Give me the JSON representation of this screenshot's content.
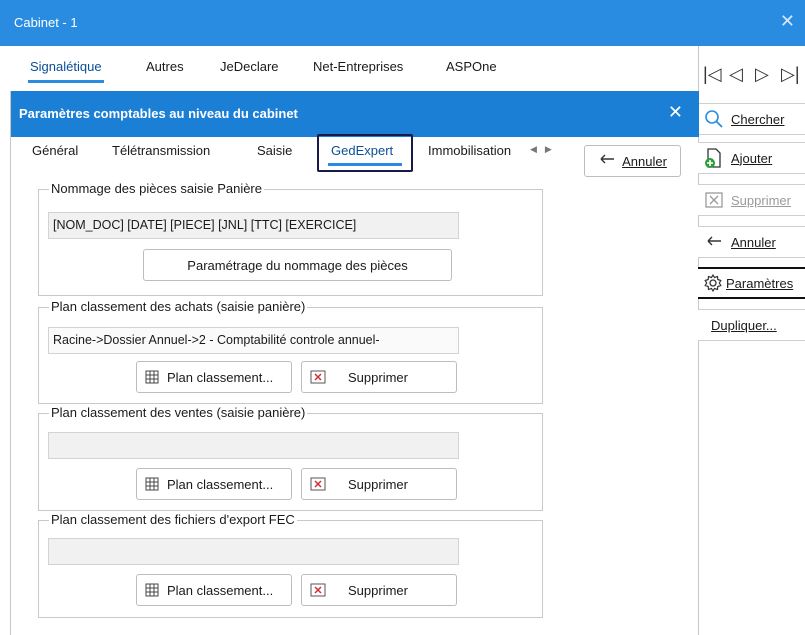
{
  "outer_window": {
    "title": "Cabinet - 1",
    "close": "✕",
    "tabs": [
      "Signalétique",
      "Autres",
      "JeDeclare",
      "Net-Entreprises",
      "ASPOne"
    ]
  },
  "nav": {
    "first": "|◁",
    "prev": "◁",
    "next": "▷",
    "last": "▷|"
  },
  "right_panel": {
    "chercher": "Chercher",
    "ajouter": "Ajouter",
    "supprimer": "Supprimer",
    "annuler": "Annuler",
    "parametres": "Paramètres",
    "dupliquer": "Dupliquer..."
  },
  "dialog": {
    "title": "Paramètres comptables au niveau du cabinet",
    "close": "✕",
    "tabs": [
      "Général",
      "Télétransmission",
      "Saisie",
      "GedExpert",
      "Immobilisation"
    ],
    "active_tab": "GedExpert",
    "annuler": "Annuler",
    "groups": [
      {
        "legend": "Nommage des pièces saisie Panière",
        "field": "[NOM_DOC]  [DATE] [PIECE] [JNL] [TTC] [EXERCICE]",
        "button": "Paramétrage du nommage des pièces"
      },
      {
        "legend": "Plan classement des achats (saisie panière)",
        "field": "Racine->Dossier Annuel->2 - Comptabilité controle annuel-",
        "plan_button": "Plan classement...",
        "delete_button": "Supprimer"
      },
      {
        "legend": "Plan classement des ventes (saisie panière)",
        "field": "",
        "plan_button": "Plan classement...",
        "delete_button": "Supprimer"
      },
      {
        "legend": "Plan classement des fichiers d'export FEC",
        "field": "",
        "plan_button": "Plan classement...",
        "delete_button": "Supprimer"
      }
    ]
  },
  "colors": {
    "title_bar": "#2a8ce0",
    "dialog_title_bar": "#1c7fd6",
    "accent": "#2a8ce0"
  }
}
